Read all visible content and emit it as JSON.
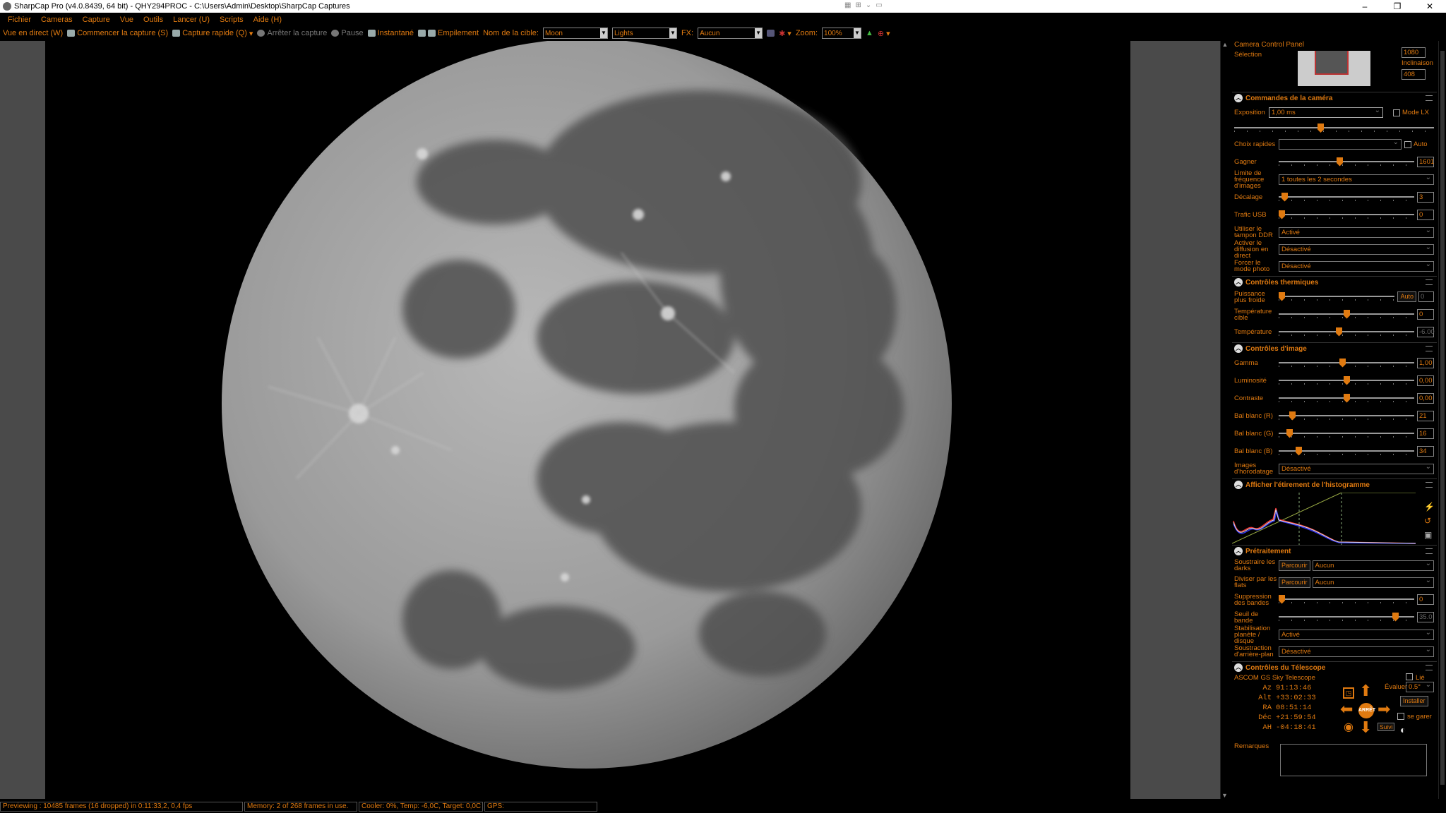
{
  "window": {
    "title": "SharpCap Pro (v4.0.8439, 64 bit) - QHY294PROC - C:\\Users\\Admin\\Desktop\\SharpCap Captures",
    "controls": [
      "–",
      "❐",
      "✕"
    ]
  },
  "menu": [
    "Fichier",
    "Cameras",
    "Capture",
    "Vue",
    "Outils",
    "Lancer (U)",
    "Scripts",
    "Aide (H)"
  ],
  "toolbar": {
    "live": "Vue en direct (W)",
    "start_capture": "Commencer la capture (S)",
    "quick_capture": "Capture rapide (Q)",
    "stop_capture": "Arrêter la capture",
    "pause": "Pause",
    "snapshot": "Instantané",
    "stack": "Empilement",
    "target_label": "Nom de la cible:",
    "target_value": "Moon",
    "frame_type": "Lights",
    "fx_label": "FX:",
    "fx_value": "Aucun",
    "zoom_label": "Zoom:",
    "zoom_value": "100%"
  },
  "panel": {
    "title": "Camera Control Panel",
    "selection": {
      "label": "Sélection",
      "value1": "1080",
      "tilt_label": "Inclinaison",
      "value2": "408"
    },
    "camera": {
      "header": "Commandes de la caméra",
      "exposure_label": "Exposition",
      "exposure_value": "1,00 ms",
      "lx_mode": "Mode LX",
      "quick_choices": "Choix rapides",
      "auto": "Auto",
      "gain_label": "Gagner",
      "gain_value": "1601",
      "gain_level": 0.45,
      "fps_limit_label": "Limite de fréquence d'images",
      "fps_limit_value": "1 toutes les 2 secondes",
      "offset_label": "Décalage",
      "offset_value": "3",
      "offset_level": 0.02,
      "usb_label": "Trafic USB",
      "usb_value": "0",
      "usb_level": 0.0,
      "ddr_label": "Utiliser le tampon DDR",
      "ddr_value": "Activé",
      "live_stream_label": "Activer le diffusion en direct",
      "live_stream_value": "Désactivé",
      "photo_mode_label": "Forcer le mode photo",
      "photo_mode_value": "Désactivé"
    },
    "thermal": {
      "header": "Contrôles thermiques",
      "cooler_label": "Puissance plus froide",
      "cooler_auto": "Auto",
      "cooler_value": "0",
      "cooler_level": 0.0,
      "target_temp_label": "Température cible",
      "target_temp_value": "0",
      "target_temp_level": 0.5,
      "temp_label": "Température",
      "temp_value": "-6.00",
      "temp_level": 0.44
    },
    "image": {
      "header": "Contrôles d'image",
      "gamma_label": "Gamma",
      "gamma_value": "1,00",
      "gamma_level": 0.47,
      "brightness_label": "Luminosité",
      "brightness_value": "0,00",
      "brightness_level": 0.5,
      "contrast_label": "Contraste",
      "contrast_value": "0,00",
      "contrast_level": 0.5,
      "wb_r_label": "Bal blanc (R)",
      "wb_r_value": "21",
      "wb_r_level": 0.08,
      "wb_g_label": "Bal blanc (G)",
      "wb_g_value": "16",
      "wb_g_level": 0.06,
      "wb_b_label": "Bal blanc (B)",
      "wb_b_value": "34",
      "wb_b_level": 0.13,
      "timestamp_label": "Images d'horodatage",
      "timestamp_value": "Désactivé"
    },
    "histogram": {
      "header": "Afficher l'étirement de l'histogramme"
    },
    "preprocessing": {
      "header": "Prétraitement",
      "darks_label": "Soustraire les darks",
      "darks_browse": "Parcourir",
      "darks_value": "Aucun",
      "flats_label": "Diviser par les flats",
      "flats_browse": "Parcourir",
      "flats_value": "Aucun",
      "banding_label": "Suppression des bandes",
      "banding_value": "0",
      "banding_level": 0.0,
      "band_threshold_label": "Seuil de bande",
      "band_threshold_value": "35.0",
      "band_threshold_level": 0.88,
      "stabilization_label": "Stabilisation planète / disque",
      "stabilization_value": "Activé",
      "background_label": "Soustraction d'arrière-plan",
      "background_value": "Désactivé"
    },
    "telescope": {
      "header": "Contrôles du Télescope",
      "device": "ASCOM GS Sky Telescope",
      "connected": "Lié",
      "rows": [
        {
          "k": "Az",
          "v": "91:13:46"
        },
        {
          "k": "Alt",
          "v": "+33:02:33"
        },
        {
          "k": "RA",
          "v": "08:51:14"
        },
        {
          "k": "Déc",
          "v": "+21:59:54"
        },
        {
          "k": "AH",
          "v": "-04:18:41"
        }
      ],
      "rate_label": "Évaluer",
      "rate_value": "0.5°",
      "install": "Installer",
      "stop": "ARRÊT",
      "park": "se garer",
      "follow": "Suivi"
    },
    "notes_label": "Remarques"
  },
  "status": {
    "preview": "Previewing : 10485 frames (16 dropped) in 0:11:33,2, 0,4 fps",
    "memory": "Memory: 2 of 268 frames in use.",
    "cooler": "Cooler: 0%, Temp: -6,0C, Target: 0,0C",
    "gps": "GPS:"
  }
}
